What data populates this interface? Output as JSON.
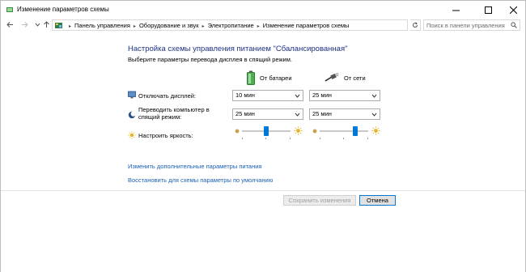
{
  "window": {
    "title": "Изменение параметров схемы"
  },
  "address": {
    "crumbs": [
      "Панель управления",
      "Оборудование и звук",
      "Электропитание",
      "Изменение параметров схемы"
    ],
    "search_placeholder": "Поиск в панели управления"
  },
  "main": {
    "heading": "Настройка схемы управления питанием \"Сбалансированная\"",
    "subheading": "Выберите параметры перевода дисплея в спящий режим.",
    "col_battery": "От батареи",
    "col_ac": "От сети",
    "rows": {
      "display_off": {
        "label": "Отключать дисплей:",
        "battery": "10 мин",
        "ac": "25 мин"
      },
      "sleep": {
        "label": "Переводить компьютер в спящий режим:",
        "battery": "25 мин",
        "ac": "25 мин"
      },
      "brightness": {
        "label": "Настроить яркость:",
        "battery_level": 0.5,
        "ac_level": 0.75
      }
    },
    "links": {
      "advanced": "Изменить дополнительные параметры питания",
      "restore": "Восстановить для схемы параметры по умолчанию"
    }
  },
  "buttons": {
    "save": "Сохранить изменения",
    "cancel": "Отмена"
  },
  "colors": {
    "heading": "#1e3287",
    "link": "#1a5fb4",
    "slider_thumb": "#0078d7"
  },
  "icons": [
    "app-icon",
    "back-arrow-icon",
    "forward-arrow-icon",
    "chevron-down-icon",
    "up-arrow-icon",
    "control-panel-icon",
    "refresh-icon",
    "search-icon",
    "battery-icon",
    "plug-icon",
    "monitor-icon",
    "moon-icon",
    "sun-icon"
  ]
}
